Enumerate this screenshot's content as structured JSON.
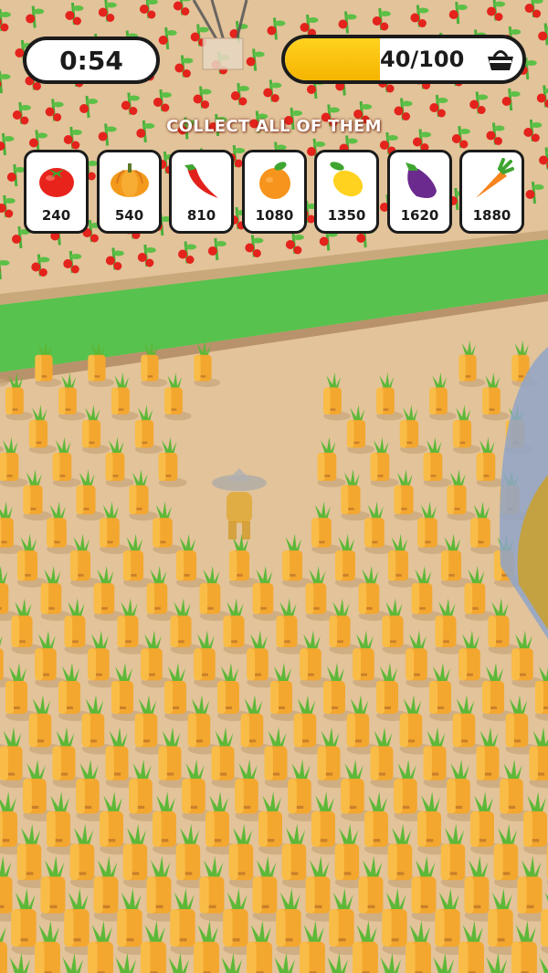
{
  "hud": {
    "timer": "0:54",
    "progress_text": "40/100",
    "progress_fraction": 0.4,
    "progress_color": "#f5b400"
  },
  "collect": {
    "title": "COLLECT ALL OF THEM",
    "items": [
      {
        "icon": "tomato-icon",
        "value": "240"
      },
      {
        "icon": "pumpkin-icon",
        "value": "540"
      },
      {
        "icon": "chili-pepper-icon",
        "value": "810"
      },
      {
        "icon": "orange-icon",
        "value": "1080"
      },
      {
        "icon": "lemon-icon",
        "value": "1350"
      },
      {
        "icon": "eggplant-icon",
        "value": "1620"
      },
      {
        "icon": "carrot-icon",
        "value": "1880"
      }
    ]
  },
  "colors": {
    "ground": "#e2c39a",
    "grass_strip": "#57c24d",
    "crop": "#f4a72e"
  }
}
